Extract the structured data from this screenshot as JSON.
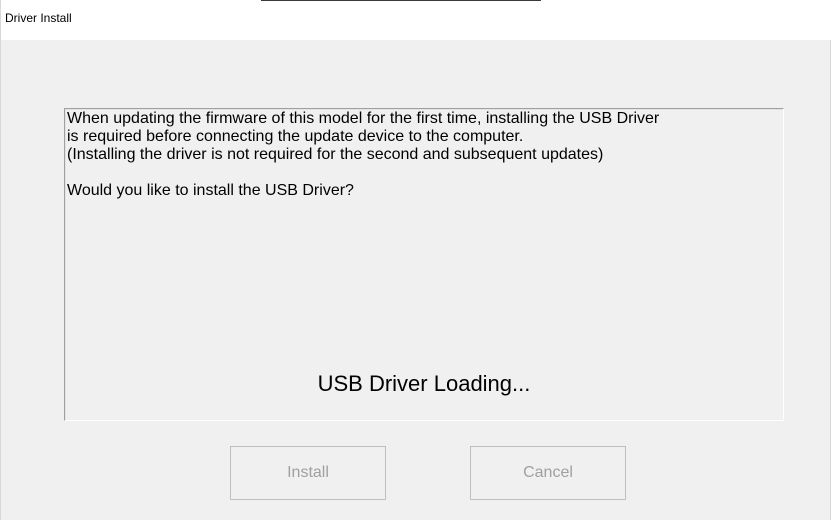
{
  "window": {
    "title": "Driver Install"
  },
  "message": {
    "lines": [
      "When updating the firmware of this model for the first time, installing the USB Driver",
      "is required before connecting the update device to the computer.",
      "(Installing the driver is not required for the second and subsequent updates)",
      "Would you like to install the USB Driver?"
    ]
  },
  "status": {
    "loading_text": "USB Driver Loading..."
  },
  "buttons": {
    "install_label": "Install",
    "install_enabled": false,
    "cancel_label": "Cancel",
    "cancel_enabled": false
  },
  "colors": {
    "background": "#f0f0f0",
    "title_bar": "#ffffff",
    "disabled_text": "#a0a0a0"
  }
}
